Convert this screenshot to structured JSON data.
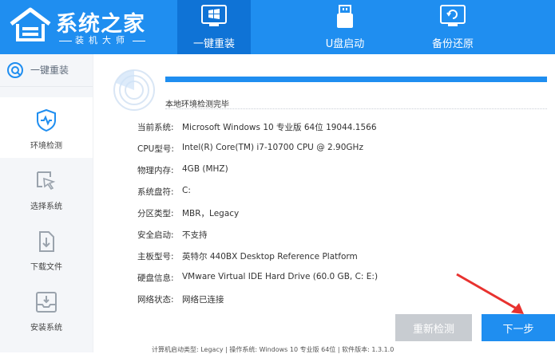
{
  "brand": {
    "title": "系统之家",
    "subtitle": "装机大师"
  },
  "nav": {
    "tabs": [
      {
        "label": "一键重装",
        "icon": "windows-icon",
        "active": true
      },
      {
        "label": "U盘启动",
        "icon": "usb-drive-icon",
        "active": false
      },
      {
        "label": "备份还原",
        "icon": "backup-restore-icon",
        "active": false
      }
    ]
  },
  "sidebar": {
    "header": {
      "label": "一键重装",
      "icon": "refresh-icon"
    },
    "items": [
      {
        "label": "环境检测",
        "icon": "shield-heartbeat-icon",
        "active": true
      },
      {
        "label": "选择系统",
        "icon": "cursor-select-icon",
        "active": false
      },
      {
        "label": "下载文件",
        "icon": "download-file-icon",
        "active": false
      },
      {
        "label": "安装系统",
        "icon": "install-tray-icon",
        "active": false
      }
    ]
  },
  "main": {
    "progress": 1.0,
    "status": "本地环境检测完毕",
    "info": [
      {
        "key": "当前系统:",
        "value": "Microsoft Windows 10 专业版 64位 19044.1566"
      },
      {
        "key": "CPU型号:",
        "value": "Intel(R) Core(TM) i7-10700 CPU @ 2.90GHz"
      },
      {
        "key": "物理内存:",
        "value": "4GB (MHZ)"
      },
      {
        "key": "系统盘符:",
        "value": "C:"
      },
      {
        "key": "分区类型:",
        "value": "MBR，Legacy"
      },
      {
        "key": "安全启动:",
        "value": "不支持"
      },
      {
        "key": "主板型号:",
        "value": "英特尔 440BX Desktop Reference Platform"
      },
      {
        "key": "硬盘信息:",
        "value": "VMware Virtual IDE Hard Drive  (60.0 GB, C: E:)"
      },
      {
        "key": "网络状态:",
        "value": "网络已连接"
      }
    ]
  },
  "buttons": {
    "recheck": "重新检测",
    "next": "下一步"
  },
  "footer": {
    "text": "计算机启动类型: Legacy | 操作系统: Windows 10 专业版 64位 | 软件版本: 1.3.1.0"
  },
  "colors": {
    "brand_blue": "#1f8ef0",
    "active_tab": "#0f73d6",
    "annotation_red": "#e8322f"
  }
}
